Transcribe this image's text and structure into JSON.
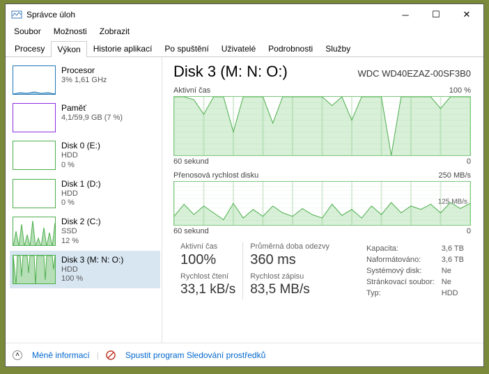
{
  "window": {
    "title": "Správce úloh"
  },
  "menu": [
    "Soubor",
    "Možnosti",
    "Zobrazit"
  ],
  "tabs": [
    "Procesy",
    "Výkon",
    "Historie aplikací",
    "Po spuštění",
    "Uživatelé",
    "Podrobnosti",
    "Služby"
  ],
  "active_tab": 1,
  "sidebar": {
    "items": [
      {
        "title": "Procesor",
        "sub": "3% 1,61 GHz",
        "border": "#1f77b4",
        "sel": false
      },
      {
        "title": "Paměť",
        "sub": "4,1/59,9 GB (7 %)",
        "border": "#8a2be2",
        "sel": false
      },
      {
        "title": "Disk 0 (E:)",
        "sub": "HDD",
        "sub2": "0 %",
        "border": "#4cae4c",
        "sel": false
      },
      {
        "title": "Disk 1 (D:)",
        "sub": "HDD",
        "sub2": "0 %",
        "border": "#4cae4c",
        "sel": false
      },
      {
        "title": "Disk 2 (C:)",
        "sub": "SSD",
        "sub2": "12 %",
        "border": "#4cae4c",
        "sel": false
      },
      {
        "title": "Disk 3 (M: N: O:)",
        "sub": "HDD",
        "sub2": "100 %",
        "border": "#4cae4c",
        "sel": true
      }
    ]
  },
  "main": {
    "title": "Disk 3 (M: N: O:)",
    "model": "WDC WD40EZAZ-00SF3B0",
    "chart1": {
      "label_left": "Aktivní čas",
      "label_right": "100 %",
      "foot_left": "60 sekund",
      "foot_right": "0"
    },
    "chart2": {
      "label_left": "Přenosová rychlost disku",
      "label_right": "250 MB/s",
      "mid": "125 MB/s",
      "foot_left": "60 sekund",
      "foot_right": "0"
    },
    "stats": {
      "active_label": "Aktivní čas",
      "active_val": "100%",
      "resp_label": "Průměrná doba odezvy",
      "resp_val": "360 ms",
      "read_label": "Rychlost čtení",
      "read_val": "33,1 kB/s",
      "write_label": "Rychlost zápisu",
      "write_val": "83,5 MB/s"
    },
    "info": [
      [
        "Kapacita:",
        "3,6 TB"
      ],
      [
        "Naformátováno:",
        "3,6 TB"
      ],
      [
        "Systémový disk:",
        "Ne"
      ],
      [
        "Stránkovací soubor:",
        "Ne"
      ],
      [
        "Typ:",
        "HDD"
      ]
    ]
  },
  "footer": {
    "less": "Méně informací",
    "open": "Spustit program Sledování prostředků"
  },
  "chart_data": [
    {
      "type": "line",
      "title": "Aktivní čas",
      "xlabel": "60 sekund → 0",
      "ylabel": "%",
      "ylim": [
        0,
        100
      ],
      "x": [
        0,
        2,
        4,
        6,
        8,
        10,
        12,
        14,
        16,
        18,
        20,
        22,
        24,
        26,
        28,
        30,
        32,
        34,
        36,
        38,
        40,
        42,
        44,
        46,
        48,
        50,
        52,
        54,
        56,
        58,
        60
      ],
      "values": [
        100,
        100,
        95,
        70,
        100,
        100,
        40,
        100,
        100,
        100,
        55,
        100,
        100,
        100,
        100,
        100,
        85,
        100,
        60,
        100,
        100,
        100,
        0,
        100,
        100,
        100,
        100,
        80,
        100,
        100,
        100
      ]
    },
    {
      "type": "line",
      "title": "Přenosová rychlost disku",
      "xlabel": "60 sekund → 0",
      "ylabel": "MB/s",
      "ylim": [
        0,
        250
      ],
      "x": [
        0,
        2,
        4,
        6,
        8,
        10,
        12,
        14,
        16,
        18,
        20,
        22,
        24,
        26,
        28,
        30,
        32,
        34,
        36,
        38,
        40,
        42,
        44,
        46,
        48,
        50,
        52,
        54,
        56,
        58,
        60
      ],
      "values": [
        50,
        120,
        60,
        110,
        70,
        30,
        125,
        40,
        90,
        50,
        110,
        70,
        50,
        95,
        60,
        40,
        120,
        55,
        90,
        40,
        110,
        60,
        130,
        70,
        110,
        90,
        120,
        70,
        130,
        95,
        125
      ]
    }
  ]
}
